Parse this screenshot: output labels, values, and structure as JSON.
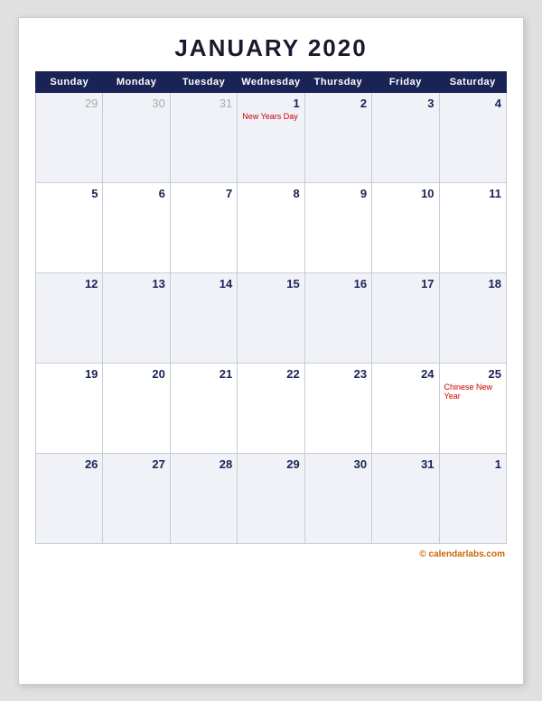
{
  "calendar": {
    "title": "JANUARY 2020",
    "headers": [
      "Sunday",
      "Monday",
      "Tuesday",
      "Wednesday",
      "Thursday",
      "Friday",
      "Saturday"
    ],
    "weeks": [
      [
        {
          "day": "29",
          "otherMonth": true,
          "holiday": ""
        },
        {
          "day": "30",
          "otherMonth": true,
          "holiday": ""
        },
        {
          "day": "31",
          "otherMonth": true,
          "holiday": ""
        },
        {
          "day": "1",
          "otherMonth": false,
          "holiday": "New Years Day"
        },
        {
          "day": "2",
          "otherMonth": false,
          "holiday": ""
        },
        {
          "day": "3",
          "otherMonth": false,
          "holiday": ""
        },
        {
          "day": "4",
          "otherMonth": false,
          "holiday": ""
        }
      ],
      [
        {
          "day": "5",
          "otherMonth": false,
          "holiday": ""
        },
        {
          "day": "6",
          "otherMonth": false,
          "holiday": ""
        },
        {
          "day": "7",
          "otherMonth": false,
          "holiday": ""
        },
        {
          "day": "8",
          "otherMonth": false,
          "holiday": ""
        },
        {
          "day": "9",
          "otherMonth": false,
          "holiday": ""
        },
        {
          "day": "10",
          "otherMonth": false,
          "holiday": ""
        },
        {
          "day": "11",
          "otherMonth": false,
          "holiday": ""
        }
      ],
      [
        {
          "day": "12",
          "otherMonth": false,
          "holiday": ""
        },
        {
          "day": "13",
          "otherMonth": false,
          "holiday": ""
        },
        {
          "day": "14",
          "otherMonth": false,
          "holiday": ""
        },
        {
          "day": "15",
          "otherMonth": false,
          "holiday": ""
        },
        {
          "day": "16",
          "otherMonth": false,
          "holiday": ""
        },
        {
          "day": "17",
          "otherMonth": false,
          "holiday": ""
        },
        {
          "day": "18",
          "otherMonth": false,
          "holiday": ""
        }
      ],
      [
        {
          "day": "19",
          "otherMonth": false,
          "holiday": ""
        },
        {
          "day": "20",
          "otherMonth": false,
          "holiday": ""
        },
        {
          "day": "21",
          "otherMonth": false,
          "holiday": ""
        },
        {
          "day": "22",
          "otherMonth": false,
          "holiday": ""
        },
        {
          "day": "23",
          "otherMonth": false,
          "holiday": ""
        },
        {
          "day": "24",
          "otherMonth": false,
          "holiday": ""
        },
        {
          "day": "25",
          "otherMonth": false,
          "holiday": "Chinese New Year"
        }
      ],
      [
        {
          "day": "26",
          "otherMonth": false,
          "holiday": ""
        },
        {
          "day": "27",
          "otherMonth": false,
          "holiday": ""
        },
        {
          "day": "28",
          "otherMonth": false,
          "holiday": ""
        },
        {
          "day": "29",
          "otherMonth": false,
          "holiday": ""
        },
        {
          "day": "30",
          "otherMonth": false,
          "holiday": ""
        },
        {
          "day": "31",
          "otherMonth": false,
          "holiday": ""
        },
        {
          "day": "1",
          "otherMonth": true,
          "holiday": ""
        }
      ]
    ],
    "footer": {
      "prefix": "©",
      "brand": "calendarlabs.com"
    }
  }
}
